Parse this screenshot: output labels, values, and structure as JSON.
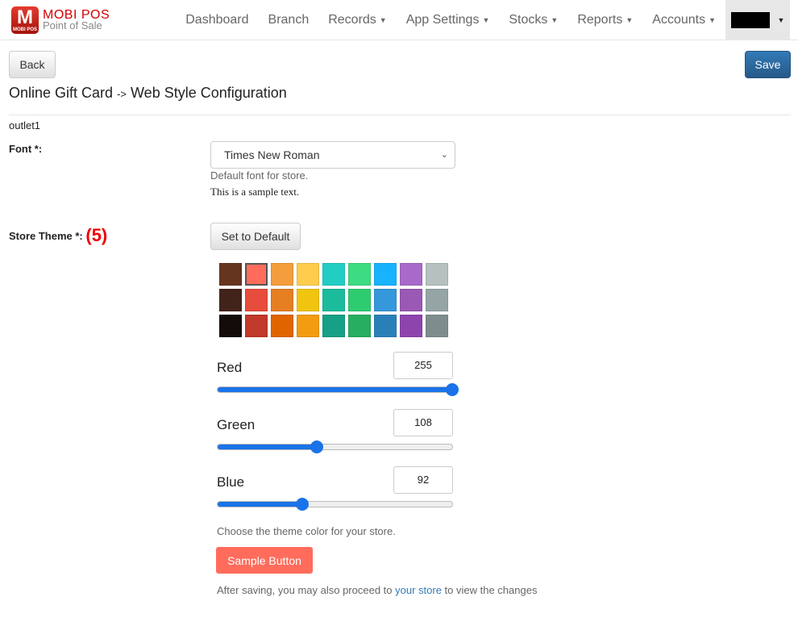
{
  "brand": {
    "title": "MOBI POS",
    "subtitle": "Point of Sale",
    "icon_letter": "M",
    "icon_small": "MOBI POS"
  },
  "nav": [
    {
      "label": "Dashboard",
      "dropdown": false
    },
    {
      "label": "Branch",
      "dropdown": false
    },
    {
      "label": "Records",
      "dropdown": true
    },
    {
      "label": "App Settings",
      "dropdown": true
    },
    {
      "label": "Stocks",
      "dropdown": true
    },
    {
      "label": "Reports",
      "dropdown": true
    },
    {
      "label": "Accounts",
      "dropdown": true
    }
  ],
  "toolbar": {
    "back": "Back",
    "save": "Save"
  },
  "title": {
    "part1": "Online Gift Card",
    "arrow": "->",
    "part2": "Web Style Configuration"
  },
  "outlet": "outlet1",
  "font": {
    "label": "Font *:",
    "value": "Times New Roman",
    "help": "Default font for store.",
    "sample": "This is a sample text."
  },
  "theme": {
    "label": "Store Theme *:",
    "annotation": "(5)",
    "default_button": "Set to Default",
    "swatches": [
      "#663520",
      "#ff6c5c",
      "#f49d3c",
      "#ffcc4d",
      "#22cdc3",
      "#3edc82",
      "#17b3fe",
      "#a969c9",
      "#b5c0bf",
      "#42231a",
      "#e74c3c",
      "#e67e22",
      "#f1c40f",
      "#1abc9c",
      "#2ecc71",
      "#3498db",
      "#9b59b6",
      "#95a5a6",
      "#140c08",
      "#c0392b",
      "#e06500",
      "#f39c12",
      "#16a085",
      "#27ae60",
      "#2980b9",
      "#8e44ad",
      "#7f8c8d"
    ],
    "selected_index": 1,
    "red": {
      "label": "Red",
      "value": 255
    },
    "green": {
      "label": "Green",
      "value": 108
    },
    "blue": {
      "label": "Blue",
      "value": 92
    },
    "help": "Choose the theme color for your store.",
    "sample_button": "Sample Button",
    "after_pre": "After saving, you may also proceed to ",
    "after_link": "your store",
    "after_post": " to view the changes"
  }
}
